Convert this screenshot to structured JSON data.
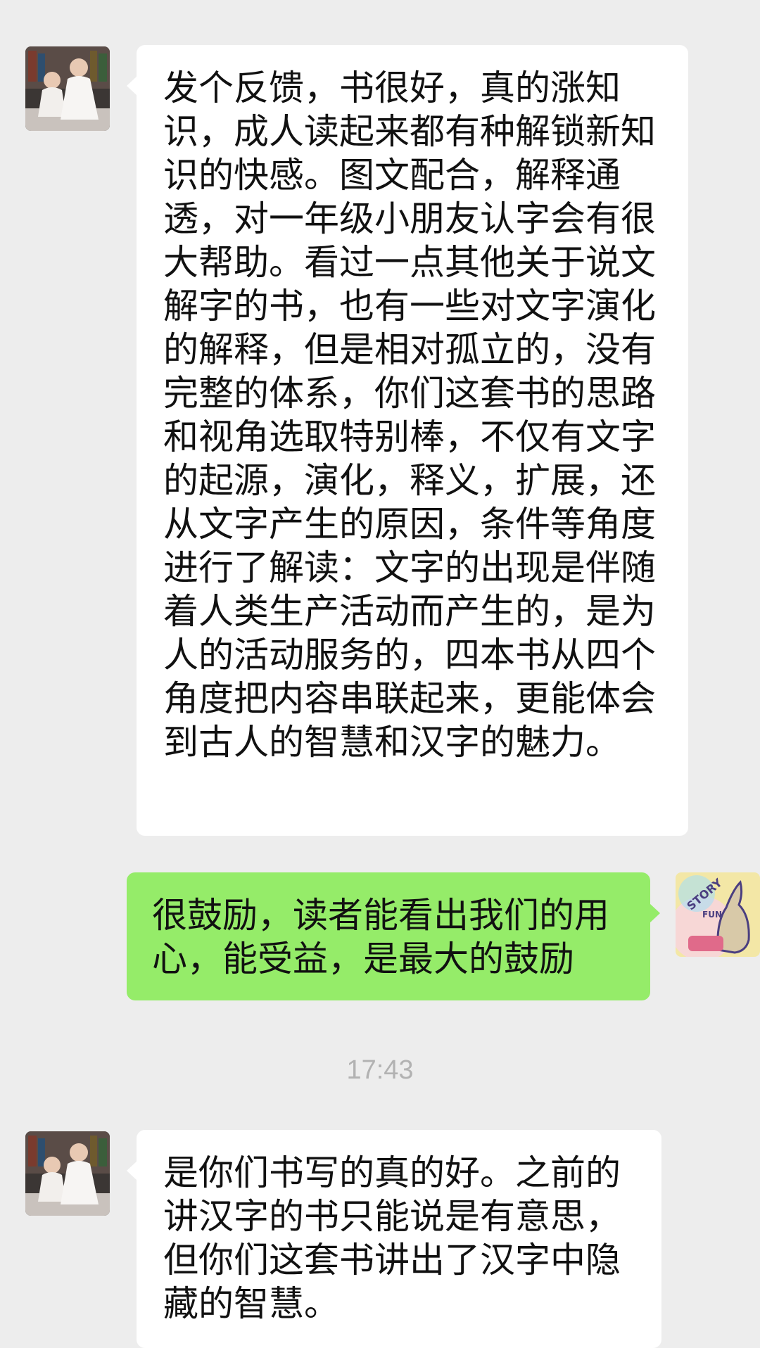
{
  "chat": {
    "messages": [
      {
        "sender": "contact",
        "text": "发个反馈，书很好，真的涨知识，成人读起来都有种解锁新知识的快感。图文配合，解释通透，对一年级小朋友认字会有很大帮助。看过一点其他关于说文解字的书，也有一些对文字演化的解释，但是相对孤立的，没有完整的体系，你们这套书的思路和视角选取特别棒，不仅有文字的起源，演化，释义，扩展，还从文字产生的原因，条件等角度进行了解读：文字的出现是伴随着人类生产活动而产生的，是为人的活动服务的，四本书从四个角度把内容串联起来，更能体会到古人的智慧和汉字的魅力。"
      },
      {
        "sender": "self",
        "text": "很鼓励，读者能看出我们的用心，能受益，是最大的鼓励"
      },
      {
        "sender": "contact",
        "text": "是你们书写的真的好。之前的讲汉字的书只能说是有意思，但你们这套书讲出了汉字中隐藏的智慧。"
      }
    ],
    "timestamp": "17:43",
    "self_avatar": {
      "arc_text": "STORY",
      "inner_text": "FUN"
    }
  },
  "colors": {
    "background": "#ededed",
    "incoming_bubble": "#ffffff",
    "outgoing_bubble": "#95ec69",
    "timestamp_text": "#b2b2b2"
  },
  "icons": {
    "contact_avatar": "two-girls-photo-avatar",
    "self_avatar": "story-fun-kangaroo-avatar"
  }
}
